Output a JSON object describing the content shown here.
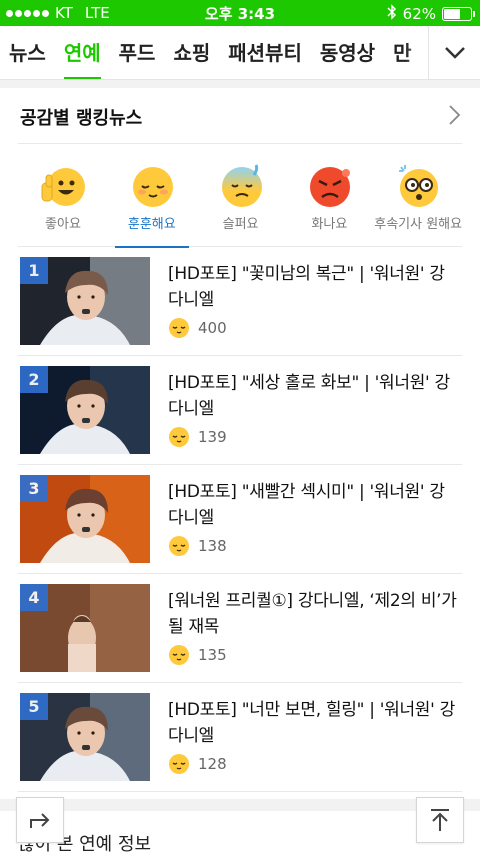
{
  "status_bar": {
    "carrier": "KT",
    "network": "LTE",
    "time": "오후 3:43",
    "battery": "62%",
    "battery_level": 0.62
  },
  "nav": {
    "tabs": [
      {
        "label": "뉴스",
        "active": false
      },
      {
        "label": "연예",
        "active": true
      },
      {
        "label": "푸드",
        "active": false
      },
      {
        "label": "쇼핑",
        "active": false
      },
      {
        "label": "패션뷰티",
        "active": false
      },
      {
        "label": "동영상",
        "active": false
      },
      {
        "label": "만",
        "active": false
      }
    ],
    "more_icon": "chevron-down-icon"
  },
  "section": {
    "title": "공감별 랭킹뉴스",
    "more_icon": "chevron-right-icon"
  },
  "emotions": [
    {
      "label": "좋아요",
      "icon": "like-emoji-icon",
      "active": false
    },
    {
      "label": "훈훈해요",
      "icon": "warm-emoji-icon",
      "active": true
    },
    {
      "label": "슬퍼요",
      "icon": "sad-emoji-icon",
      "active": false
    },
    {
      "label": "화나요",
      "icon": "angry-emoji-icon",
      "active": false
    },
    {
      "label": "후속기사 원해요",
      "icon": "want-more-emoji-icon",
      "active": false
    }
  ],
  "articles": [
    {
      "rank": "1",
      "headline": "[HD포토] \"꽃미남의 복근\" | '워너원' 강다니엘",
      "count": "400"
    },
    {
      "rank": "2",
      "headline": "[HD포토] \"세상 홀로 화보\" | '워너원' 강다니엘",
      "count": "139"
    },
    {
      "rank": "3",
      "headline": "[HD포토] \"새빨간 섹시미\" | '워너원' 강다니엘",
      "count": "138"
    },
    {
      "rank": "4",
      "headline": "[워너원 프리퀄①] 강다니엘, ‘제2의 비’가 될 재목",
      "count": "135"
    },
    {
      "rank": "5",
      "headline": "[HD포토] \"너만 보면, 힐링\" | '워너원' 강다니엘",
      "count": "128"
    }
  ],
  "next_section": {
    "title": "많이 본 연예 정보"
  },
  "buttons": {
    "share_icon": "share-icon",
    "top_icon": "scroll-top-icon"
  },
  "colors": {
    "brand_green": "#1ec800",
    "active_blue": "#1a73c8",
    "rank_badge": "#2f6fd0"
  }
}
